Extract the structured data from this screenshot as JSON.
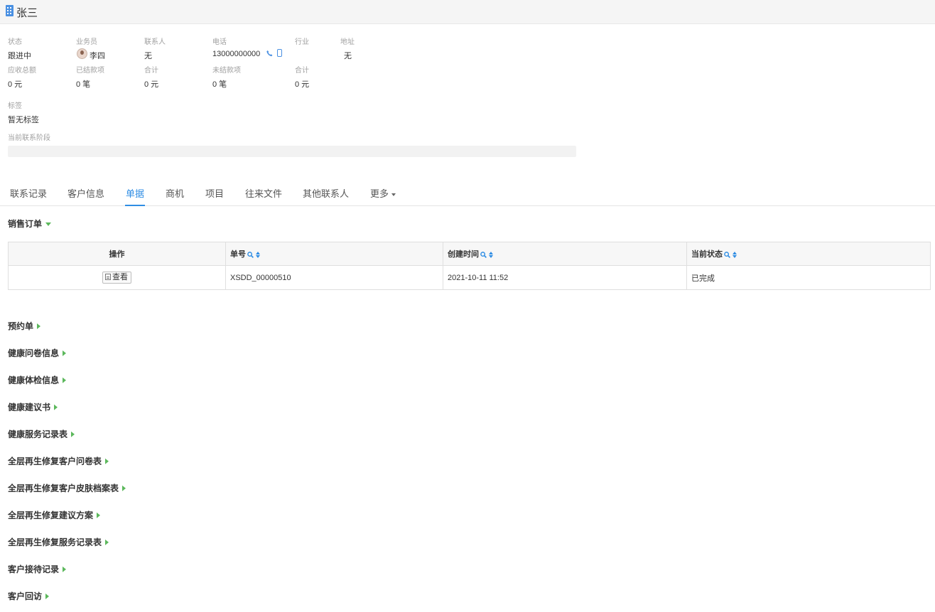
{
  "header": {
    "title": "张三",
    "icon": "building-icon"
  },
  "info": {
    "row1_labels": [
      "状态",
      "业务员",
      "联系人",
      "电话",
      "行业",
      "地址"
    ],
    "status": "跟进中",
    "salesperson": "李四",
    "contact": "无",
    "phone": "13000000000",
    "industry": "",
    "address": "无",
    "row2_labels": [
      "应收总额",
      "已结款项",
      "合计",
      "未结款项",
      "合计"
    ],
    "receivable_total": "0 元",
    "settled_items": "0 笔",
    "settled_sum": "0 元",
    "unsettled_items": "0 笔",
    "unsettled_sum": "0 元",
    "tags_label": "标签",
    "tags_value": "暂无标签",
    "stage_label": "当前联系阶段"
  },
  "tabs": [
    "联系记录",
    "客户信息",
    "单据",
    "商机",
    "项目",
    "往来文件",
    "其他联系人",
    "更多"
  ],
  "active_tab": "单据",
  "sales_order": {
    "title": "销售订单",
    "columns": [
      "操作",
      "单号",
      "创建时间",
      "当前状态"
    ],
    "rows": [
      {
        "action": "查看",
        "number": "XSDD_00000510",
        "created": "2021-10-11 11:52",
        "status": "已完成"
      }
    ]
  },
  "sections": [
    "预约单",
    "健康问卷信息",
    "健康体检信息",
    "健康建议书",
    "健康服务记录表",
    "全层再生修复客户问卷表",
    "全层再生修复客户皮肤档案表",
    "全层再生修复建议方案",
    "全层再生修复服务记录表",
    "客户接待记录",
    "客户回访"
  ],
  "colors": {
    "accent": "#2f8de4",
    "expander": "#5cb85c"
  }
}
